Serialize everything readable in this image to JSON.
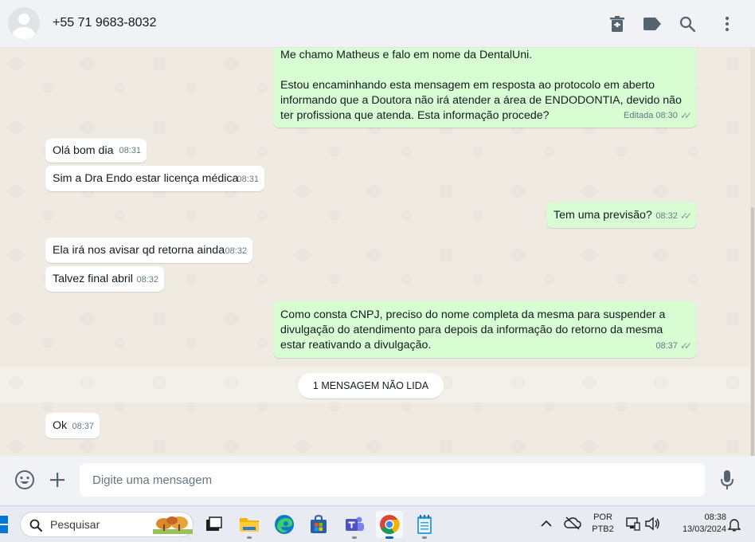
{
  "header": {
    "contact": "+55 71 9683-8032",
    "icons": [
      "delete-icon",
      "label-icon",
      "search-icon",
      "menu-icon"
    ]
  },
  "messages": [
    {
      "dir": "out",
      "text": "Me chamo Matheus e falo em nome da DentalUni.\n\nEstou encaminhando esta mensagem em resposta ao protocolo em aberto informando que a Doutora não irá atender a área de ENDODONTIA, devido não ter profissiona que atenda. Esta informação procede?",
      "meta": "Editada 08:30"
    },
    {
      "dir": "in",
      "text": "Olá bom dia",
      "time": "08:31"
    },
    {
      "dir": "in",
      "text": "Sim a Dra Endo estar licença médica",
      "time": "08:31"
    },
    {
      "dir": "out",
      "text": "Tem uma previsão?",
      "time": "08:32"
    },
    {
      "dir": "in",
      "text": "Ela irá nos avisar qd retorna ainda",
      "time": "08:32"
    },
    {
      "dir": "in",
      "text": "Talvez final abril",
      "time": "08:32"
    },
    {
      "dir": "out",
      "text": "Como consta CNPJ, preciso do nome completa da mesma para suspender a divulgação do atendimento para depois da informação do retorno da mesma estar reativando a divulgação.",
      "time": "08:37"
    },
    {
      "dir": "in",
      "text": "Ok",
      "time": "08:37"
    }
  ],
  "unread_label": "1 MENSAGEM NÃO LIDA",
  "composer": {
    "placeholder": "Digite uma mensagem"
  },
  "taskbar": {
    "search_label": "Pesquisar",
    "apps": [
      "task-view-icon",
      "file-explorer-icon",
      "edge-icon",
      "store-icon",
      "teams-icon",
      "chrome-icon",
      "notepad-icon"
    ],
    "lang_line1": "POR",
    "lang_line2": "PTB2",
    "time": "08:38",
    "date": "13/03/2024"
  }
}
